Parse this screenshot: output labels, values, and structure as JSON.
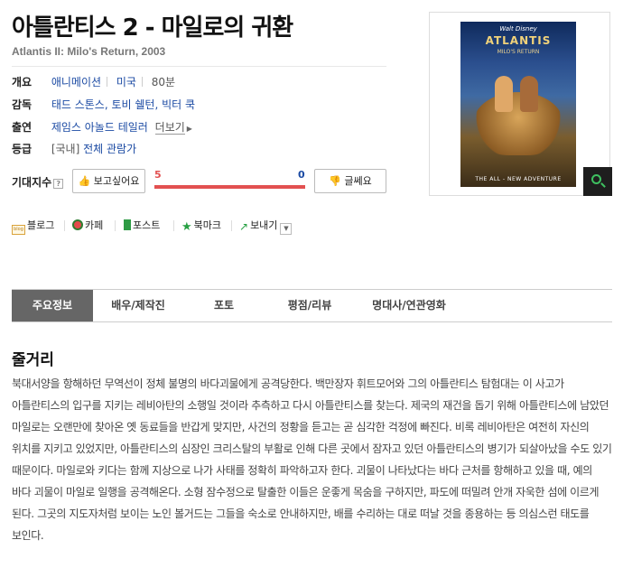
{
  "title": "아틀란티스 2 - 마일로의 귀환",
  "original_title": "Atlantis II: Milo's Return, 2003",
  "info": {
    "overview": {
      "label": "개요",
      "genre": "애니메이션",
      "country": "미국",
      "runtime": "80분"
    },
    "director": {
      "label": "감독",
      "names": "태드 스톤스, 토비 쉘턴, 빅터 쿡"
    },
    "cast": {
      "label": "출연",
      "names": "제임스 아놀드 테일러",
      "more": "더보기"
    },
    "rating": {
      "label": "등급",
      "region": "[국내]",
      "value": "전체 관람가"
    }
  },
  "expectation": {
    "label": "기대지수",
    "help": "?",
    "want_label": "보고싶어요",
    "meh_label": "글쎄요",
    "want_count": "5",
    "meh_count": "0",
    "want_ratio": 1.0
  },
  "poster": {
    "studio": "Walt Disney",
    "logo_text": "ATLANTIS",
    "logo_sub": "MILO'S RETURN",
    "tagline": "THE ALL - NEW ADVENTURE"
  },
  "share": {
    "blog": "블로그",
    "cafe": "카페",
    "post": "포스트",
    "bookmark": "북마크",
    "send": "보내기"
  },
  "tabs": [
    {
      "label": "주요정보",
      "active": true
    },
    {
      "label": "배우/제작진",
      "active": false
    },
    {
      "label": "포토",
      "active": false
    },
    {
      "label": "평점/리뷰",
      "active": false
    },
    {
      "label": "명대사/연관영화",
      "active": false
    }
  ],
  "synopsis": {
    "heading": "줄거리",
    "text": "북대서양을 항해하던 무역선이 정체 불명의 바다괴물에게 공격당한다. 백만장자 휘트모어와 그의 아틀란티스 탐험대는 이 사고가 아틀란티스의 입구를 지키는 레비아탄의 소행일 것이라 추측하고 다시 아틀란티스를 찾는다. 제국의 재건을 돕기 위해 아틀란티스에 남았던 마일로는 오랜만에 찾아온 옛 동료들을 반갑게 맞지만, 사건의 정황을 듣고는 곧 심각한 걱정에 빠진다. 비록 레비아탄은 여전히 자신의 위치를 지키고 있었지만, 아틀란티스의 심장인 크리스탈의 부활로 인해 다른 곳에서 잠자고 있던 아틀란티스의 병기가 되살아났을 수도 있기 때문이다. 마일로와 키다는 함께 지상으로 나가 사태를 정확히 파악하고자 한다. 괴물이 나타났다는 바다 근처를 항해하고 있을 때, 예의 바다 괴물이 마일로 일행을 공격해온다. 소형 잠수정으로 탈출한 이들은 운좋게 목숨을 구하지만, 파도에 떠밀려 안개 자욱한 섬에 이르게 된다. 그곳의 지도자처럼 보이는 노인 볼거드는 그들을 숙소로 안내하지만, 배를 수리하는 대로 떠날 것을 종용하는 등 의심스런 태도를 보인다."
  },
  "colors": {
    "accent_red": "#e25050",
    "link_blue": "#1b4aa3",
    "active_tab": "#666666",
    "zoom_green": "#3ec060"
  }
}
